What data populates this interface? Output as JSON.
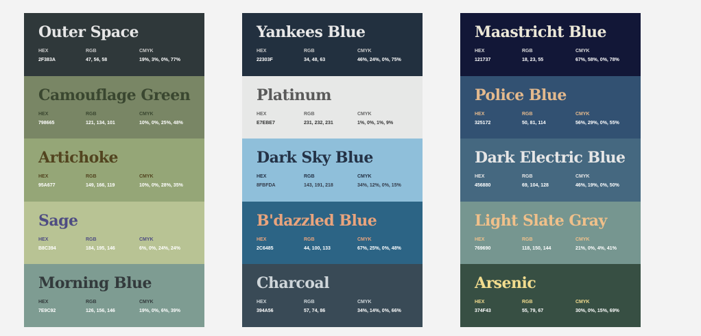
{
  "palettes": [
    {
      "swatches": [
        {
          "name": "Outer Space",
          "hex": "2F383A",
          "rgb": "47, 56, 58",
          "cmyk": "19%, 3%, 0%, 77%",
          "bg": "#2f383a",
          "name_color": "#e6e6e6",
          "label_color": "#c9c9c9",
          "value_color": "#ffffff"
        },
        {
          "name": "Camouflage Green",
          "hex": "798665",
          "rgb": "121, 134, 101",
          "cmyk": "10%, 0%, 25%, 48%",
          "bg": "#798665",
          "name_color": "#3a4730",
          "label_color": "#3a4730",
          "value_color": "#ffffff"
        },
        {
          "name": "Artichoke",
          "hex": "95A677",
          "rgb": "149, 166, 119",
          "cmyk": "10%, 0%, 28%, 35%",
          "bg": "#95a677",
          "name_color": "#52441f",
          "label_color": "#52441f",
          "value_color": "#ffffff"
        },
        {
          "name": "Sage",
          "hex": "B8C394",
          "rgb": "184, 195, 146",
          "cmyk": "6%, 0%, 24%, 24%",
          "bg": "#b8c394",
          "name_color": "#4e4c82",
          "label_color": "#4e4c82",
          "value_color": "#ffffff"
        },
        {
          "name": "Morning Blue",
          "hex": "7E9C92",
          "rgb": "126, 156, 146",
          "cmyk": "19%, 0%, 6%, 39%",
          "bg": "#7e9c92",
          "name_color": "#333a3c",
          "label_color": "#333a3c",
          "value_color": "#ffffff"
        }
      ]
    },
    {
      "swatches": [
        {
          "name": "Yankees Blue",
          "hex": "22303F",
          "rgb": "34, 48, 63",
          "cmyk": "46%, 24%, 0%, 75%",
          "bg": "#22303f",
          "name_color": "#e8e8e8",
          "label_color": "#c9c9c9",
          "value_color": "#ffffff"
        },
        {
          "name": "Platinum",
          "hex": "E7EBE7",
          "rgb": "231, 232, 231",
          "cmyk": "1%, 0%, 1%, 9%",
          "bg": "#e7e8e7",
          "name_color": "#5a5a5a",
          "label_color": "#666666",
          "value_color": "#333333"
        },
        {
          "name": "Dark Sky Blue",
          "hex": "8FBFDA",
          "rgb": "143, 191, 218",
          "cmyk": "34%, 12%, 0%, 15%",
          "bg": "#8fbfda",
          "name_color": "#243246",
          "label_color": "#243246",
          "value_color": "#333a48"
        },
        {
          "name": "B'dazzled Blue",
          "hex": "2C6485",
          "rgb": "44, 100, 133",
          "cmyk": "67%, 25%, 0%, 48%",
          "bg": "#2c6485",
          "name_color": "#e9a47d",
          "label_color": "#e9a47d",
          "value_color": "#ffffff"
        },
        {
          "name": "Charcoal",
          "hex": "394A56",
          "rgb": "57, 74, 86",
          "cmyk": "34%, 14%, 0%, 66%",
          "bg": "#394a56",
          "name_color": "#cfd6da",
          "label_color": "#cfd6da",
          "value_color": "#ffffff"
        }
      ]
    },
    {
      "swatches": [
        {
          "name": "Maastricht Blue",
          "hex": "121737",
          "rgb": "18, 23, 55",
          "cmyk": "67%, 58%, 0%, 78%",
          "bg": "#121737",
          "name_color": "#ece8d8",
          "label_color": "#d9d9d9",
          "value_color": "#ffffff"
        },
        {
          "name": "Police Blue",
          "hex": "325172",
          "rgb": "50, 81, 114",
          "cmyk": "56%, 29%, 0%, 55%",
          "bg": "#325172",
          "name_color": "#e3b98d",
          "label_color": "#e3b98d",
          "value_color": "#ffffff"
        },
        {
          "name": "Dark Electric Blue",
          "hex": "456880",
          "rgb": "69, 104, 128",
          "cmyk": "46%, 19%, 0%, 50%",
          "bg": "#456880",
          "name_color": "#e6e6e6",
          "label_color": "#e6e6e6",
          "value_color": "#ffffff"
        },
        {
          "name": "Light Slate Gray",
          "hex": "769690",
          "rgb": "118, 150, 144",
          "cmyk": "21%, 0%, 4%, 41%",
          "bg": "#769690",
          "name_color": "#f0c08a",
          "label_color": "#f0c08a",
          "value_color": "#ffffff"
        },
        {
          "name": "Arsenic",
          "hex": "374F43",
          "rgb": "55, 79, 67",
          "cmyk": "30%, 0%, 15%, 69%",
          "bg": "#374f43",
          "name_color": "#f2dc8e",
          "label_color": "#f2dc8e",
          "value_color": "#ffffff"
        }
      ]
    }
  ],
  "labels": {
    "hex": "HEX",
    "rgb": "RGB",
    "cmyk": "CMYK"
  }
}
